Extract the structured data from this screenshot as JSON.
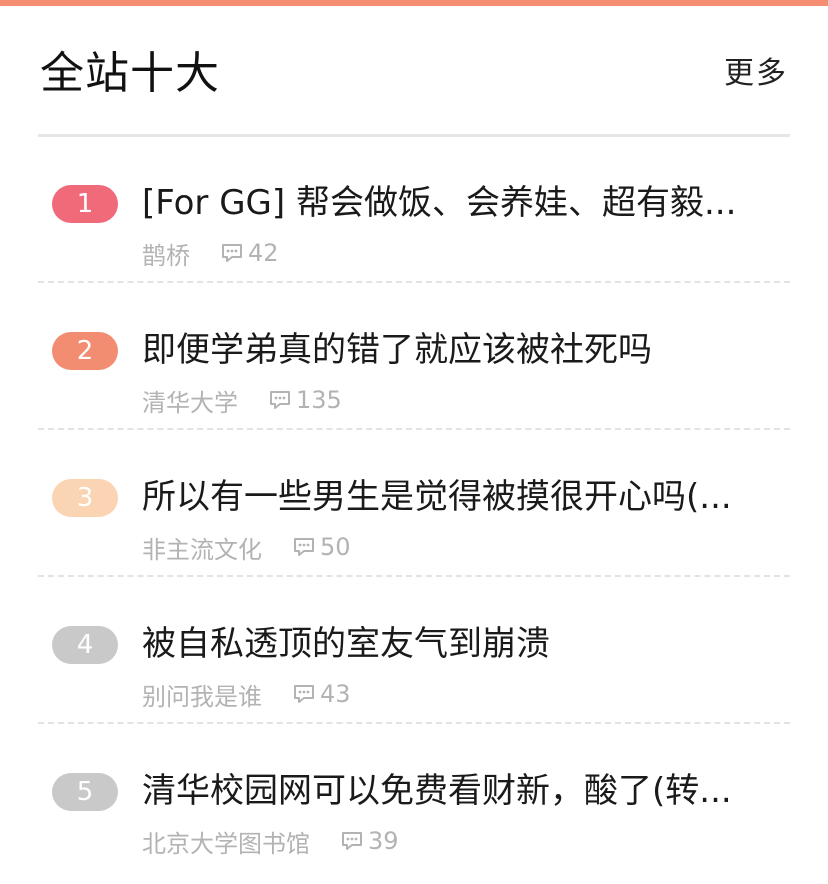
{
  "colors": {
    "accent_bar": "#f58d72",
    "rank_1": "#f06a7a",
    "rank_2": "#f28d72",
    "rank_3": "#fbd4b4",
    "rank_other": "#c9c9c9",
    "meta_text": "#b3b3b3"
  },
  "header": {
    "title": "全站十大",
    "more_label": "更多"
  },
  "icons": {
    "reply": "comment-icon"
  },
  "topics": [
    {
      "rank": "1",
      "title": "[For GG] 帮会做饭、会养娃、超有毅...",
      "board": "鹊桥",
      "replies": "42"
    },
    {
      "rank": "2",
      "title": "即便学弟真的错了就应该被社死吗",
      "board": "清华大学",
      "replies": "135"
    },
    {
      "rank": "3",
      "title": "所以有一些男生是觉得被摸很开心吗(...",
      "board": "非主流文化",
      "replies": "50"
    },
    {
      "rank": "4",
      "title": "被自私透顶的室友气到崩溃",
      "board": "别问我是谁",
      "replies": "43"
    },
    {
      "rank": "5",
      "title": "清华校园网可以免费看财新，酸了(转...",
      "board": "北京大学图书馆",
      "replies": "39"
    }
  ]
}
